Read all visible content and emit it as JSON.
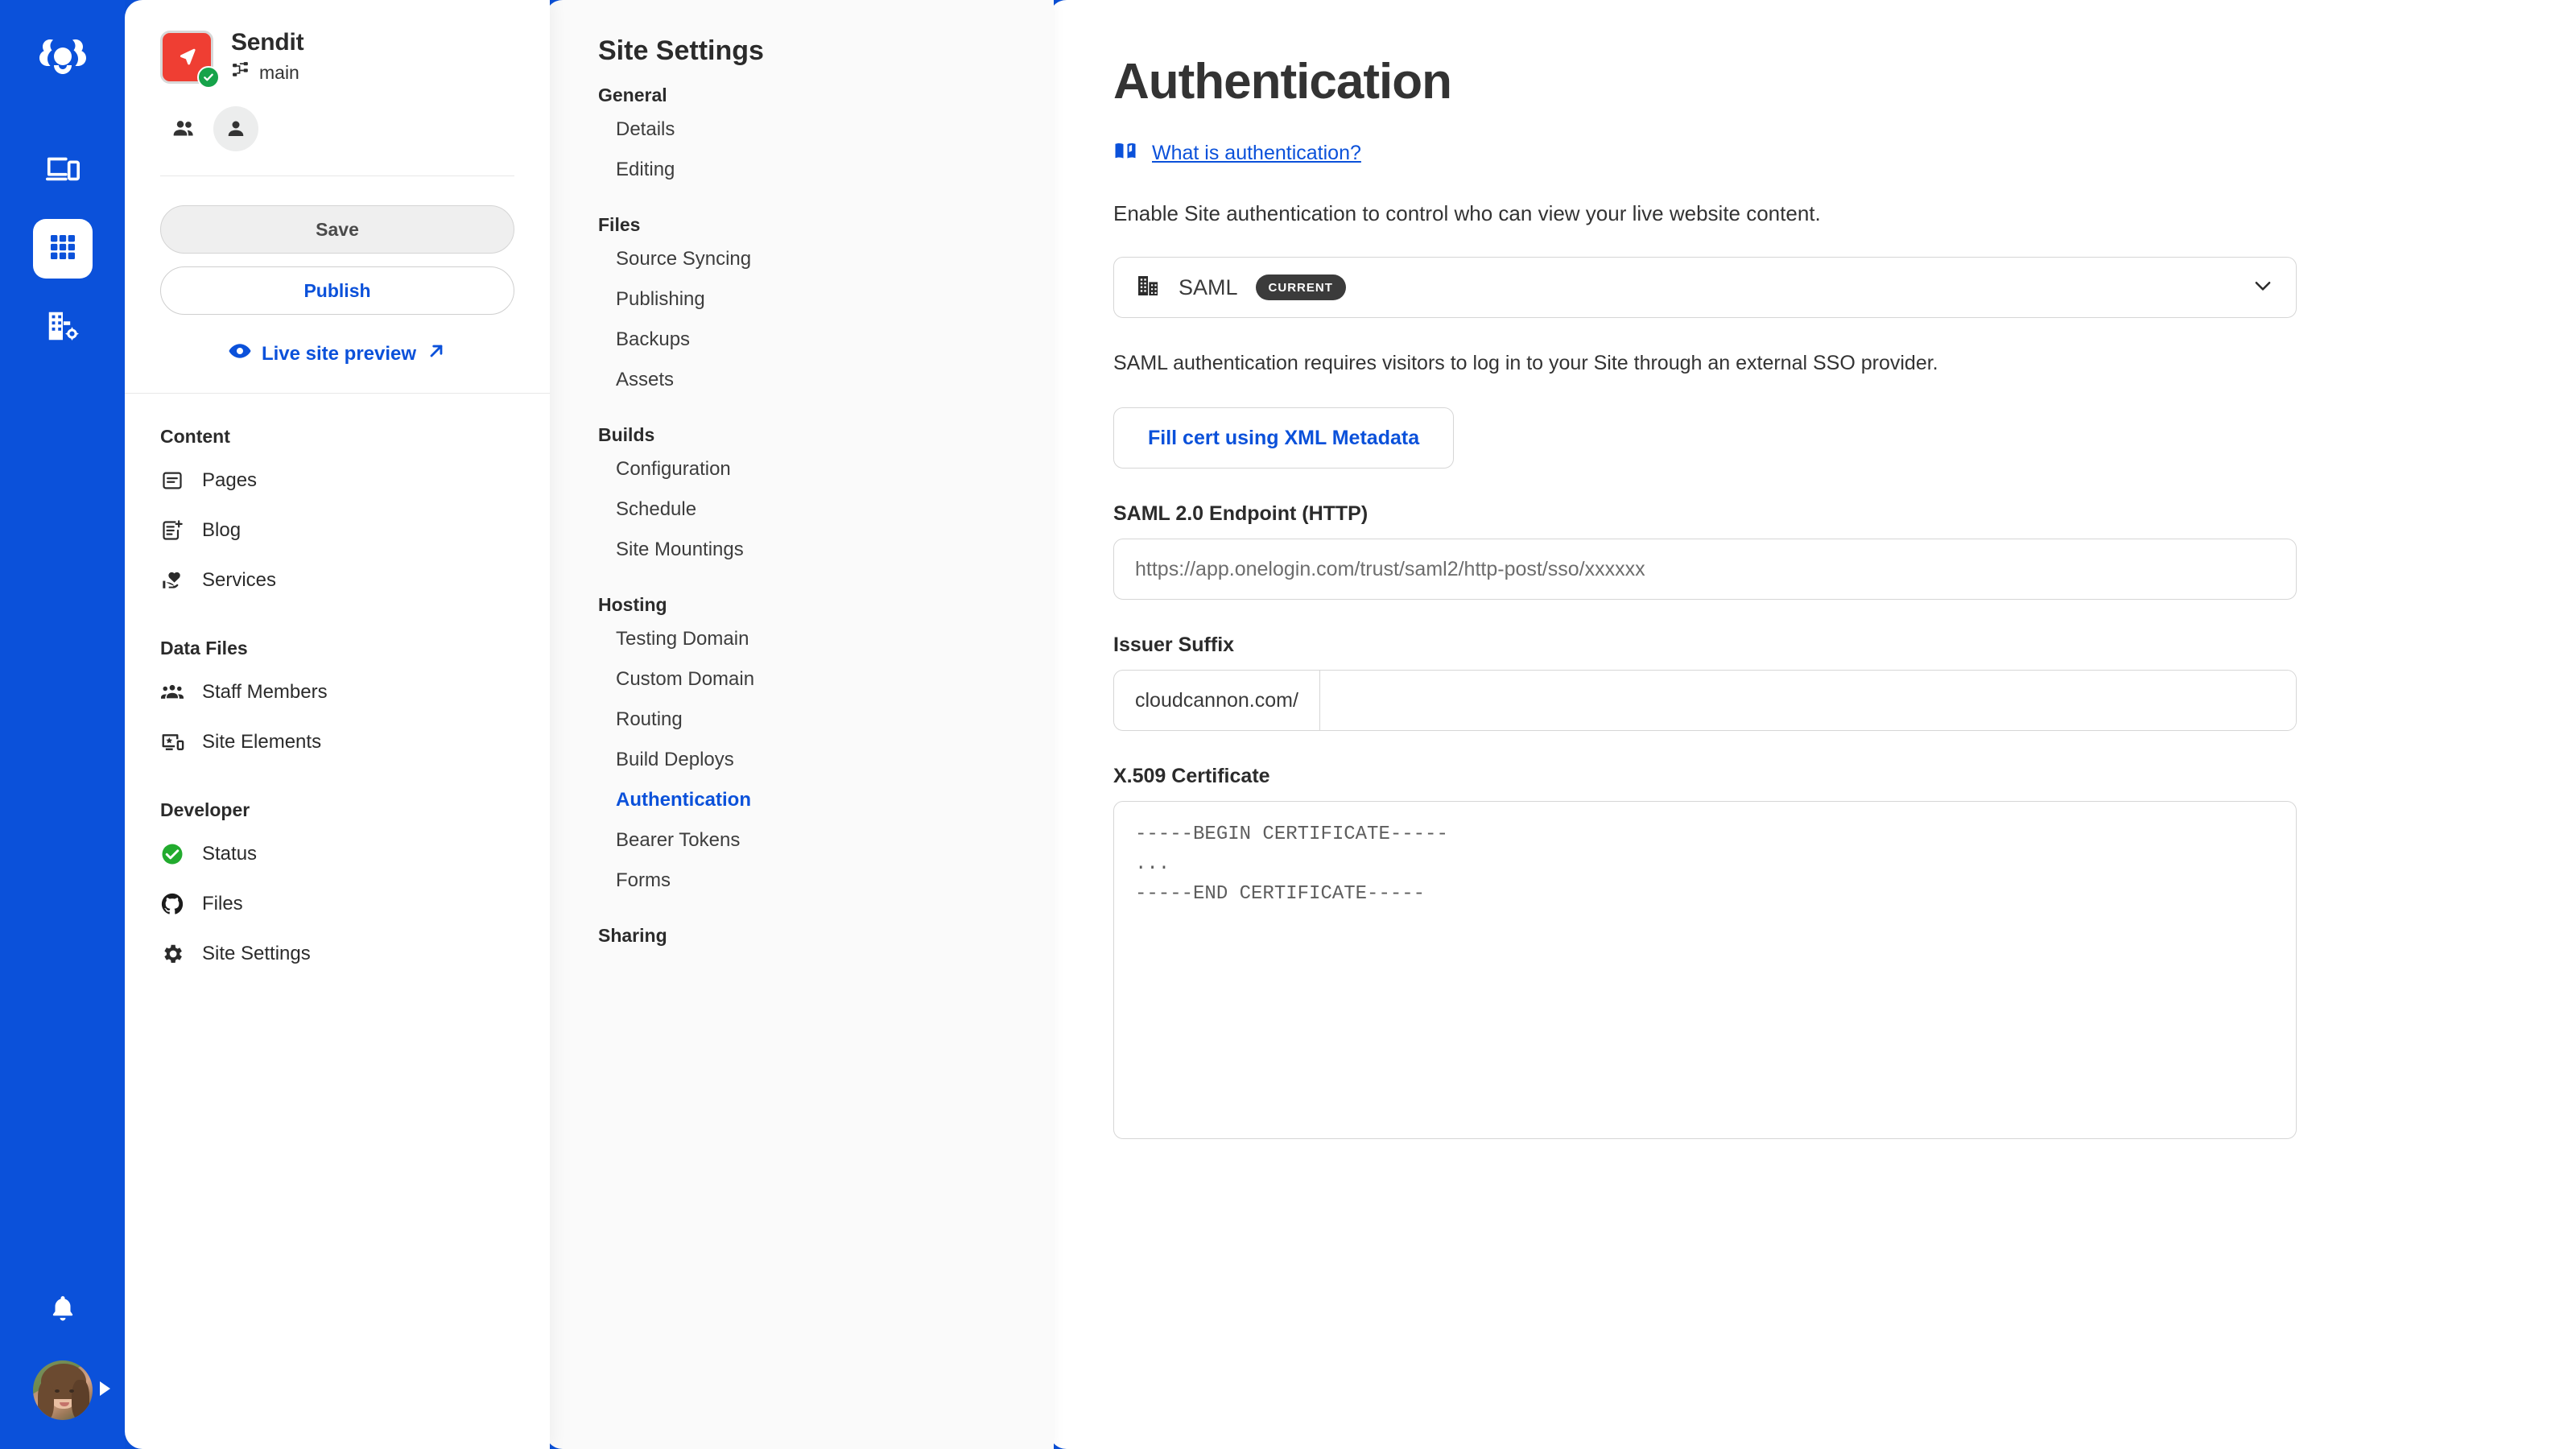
{
  "colors": {
    "brand_blue": "#0b51da",
    "accent_red": "#ef3e33",
    "status_green": "#16a34a",
    "badge_dark": "#3b3b3b"
  },
  "rail": {
    "logo_icon": "cloudcannon-logo-icon",
    "items": [
      {
        "icon": "devices-icon",
        "name": "visual-editor",
        "active": false
      },
      {
        "icon": "grid-apps-icon",
        "name": "app-grid",
        "active": true
      },
      {
        "icon": "organisation-settings-icon",
        "name": "organisation-settings",
        "active": false
      }
    ],
    "bell_icon": "bell-icon",
    "avatar_caret_icon": "caret-right-icon"
  },
  "site": {
    "name": "Sendit",
    "branch": "main",
    "branch_icon": "branch-icon",
    "logo_status_icon": "check-icon",
    "people_icon": "people-icon",
    "person_icon": "person-icon",
    "save_label": "Save",
    "publish_label": "Publish",
    "live_preview_label": "Live site preview",
    "live_preview_icon": "eye-icon",
    "live_preview_external_icon": "arrow-up-right-icon",
    "groups": [
      {
        "title": "Content",
        "items": [
          {
            "label": "Pages",
            "icon": "page-icon"
          },
          {
            "label": "Blog",
            "icon": "blog-icon"
          },
          {
            "label": "Services",
            "icon": "services-heart-hand-icon"
          }
        ]
      },
      {
        "title": "Data Files",
        "items": [
          {
            "label": "Staff Members",
            "icon": "staff-members-icon"
          },
          {
            "label": "Site Elements",
            "icon": "site-elements-icon"
          }
        ]
      },
      {
        "title": "Developer",
        "items": [
          {
            "label": "Status",
            "icon": "status-check-icon"
          },
          {
            "label": "Files",
            "icon": "github-icon"
          },
          {
            "label": "Site Settings",
            "icon": "gear-icon"
          }
        ]
      }
    ]
  },
  "settings_nav": {
    "title": "Site Settings",
    "groups": [
      {
        "title": "General",
        "items": [
          "Details",
          "Editing"
        ]
      },
      {
        "title": "Files",
        "items": [
          "Source Syncing",
          "Publishing",
          "Backups",
          "Assets"
        ]
      },
      {
        "title": "Builds",
        "items": [
          "Configuration",
          "Schedule",
          "Site Mountings"
        ]
      },
      {
        "title": "Hosting",
        "items": [
          "Testing Domain",
          "Custom Domain",
          "Routing",
          "Build Deploys",
          "Authentication",
          "Bearer Tokens",
          "Forms"
        ]
      },
      {
        "title": "Sharing",
        "items": []
      }
    ],
    "active_item": "Authentication"
  },
  "main": {
    "title": "Authentication",
    "doc_link_label": "What is authentication?",
    "doc_link_icon": "book-icon",
    "intro": "Enable Site authentication to control who can view your live website content.",
    "method_select": {
      "icon": "building-icon",
      "value": "SAML",
      "badge": "CURRENT",
      "chevron_icon": "chevron-down-icon"
    },
    "method_description": "SAML authentication requires visitors to log in to your Site through an external SSO provider.",
    "fill_cert_button": "Fill cert using XML Metadata",
    "fields": {
      "endpoint_label": "SAML 2.0 Endpoint (HTTP)",
      "endpoint_placeholder": "https://app.onelogin.com/trust/saml2/http-post/sso/xxxxxx",
      "endpoint_value": "",
      "issuer_label": "Issuer Suffix",
      "issuer_prefix": "cloudcannon.com/",
      "issuer_value": "",
      "cert_label": "X.509 Certificate",
      "cert_placeholder": "-----BEGIN CERTIFICATE-----\n...\n-----END CERTIFICATE-----",
      "cert_value": ""
    }
  }
}
